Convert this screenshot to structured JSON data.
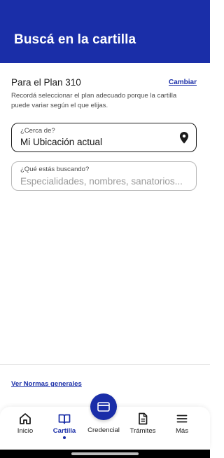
{
  "header": {
    "title": "Buscá en la cartilla"
  },
  "plan": {
    "name": "Para el Plan 310",
    "change_label": "Cambiar",
    "note": "Recordá seleccionar el plan adecuado porque la cartilla puede variar según el que elijas."
  },
  "location_field": {
    "label": "¿Cerca de?",
    "value": "Mi Ubicación actual",
    "icon": "location-pin-icon"
  },
  "search_field": {
    "label": "¿Qué estás buscando?",
    "placeholder": "Especialidades, nombres, sanatorios...",
    "value": ""
  },
  "footer": {
    "norms_link": "Ver Normas generales"
  },
  "bottom_nav": {
    "items": [
      {
        "label": "Inicio",
        "icon": "home-icon",
        "active": false
      },
      {
        "label": "Cartilla",
        "icon": "book-icon",
        "active": true
      },
      {
        "label": "Credencial",
        "icon": "card-icon",
        "active": false
      },
      {
        "label": "Trámites",
        "icon": "document-icon",
        "active": false
      },
      {
        "label": "Más",
        "icon": "menu-icon",
        "active": false
      }
    ]
  },
  "colors": {
    "brand": "#1a2ea8",
    "text": "#1c1c1c",
    "muted_text": "#4a4a4a",
    "placeholder": "#9a9a9a",
    "background": "#ffffff"
  }
}
